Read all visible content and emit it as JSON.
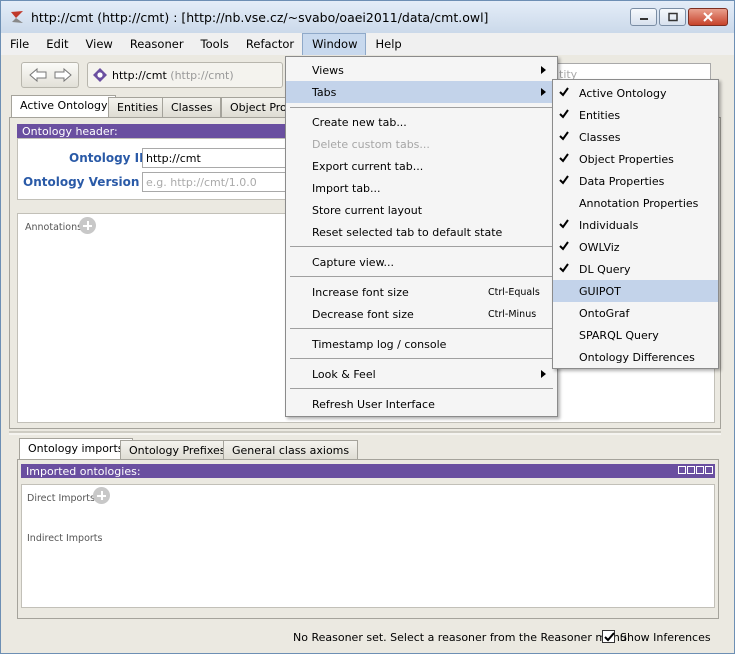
{
  "window": {
    "title": "http://cmt (http://cmt)  : [http://nb.vse.cz/~svabo/oaei2011/data/cmt.owl]"
  },
  "menubar": {
    "items": [
      "File",
      "Edit",
      "View",
      "Reasoner",
      "Tools",
      "Refactor",
      "Window",
      "Help"
    ],
    "active": "Window"
  },
  "toolbar": {
    "iri": "http://cmt",
    "iri_suffix": "(http://cmt)",
    "search_placeholder": "tity"
  },
  "tabs": [
    "Active Ontology",
    "Entities",
    "Classes",
    "Object Prop"
  ],
  "ontology_header": {
    "title": "Ontology header:",
    "iri_label": "Ontology IRI",
    "iri_value": "http://cmt",
    "version_label": "Ontology Version IRI",
    "version_placeholder": "e.g. http://cmt/1.0.0"
  },
  "annotations_label": "Annotations",
  "bottom_tabs": [
    "Ontology imports",
    "Ontology Prefixes",
    "General class axioms"
  ],
  "imports": {
    "title": "Imported ontologies:",
    "direct_label": "Direct Imports",
    "indirect_label": "Indirect Imports"
  },
  "status": {
    "text": "No Reasoner set. Select a reasoner from the Reasoner menu",
    "show_inferences_label": "Show Inferences",
    "show_inferences_checked": true
  },
  "window_menu": {
    "items": [
      {
        "label": "Views",
        "submenu": true
      },
      {
        "label": "Tabs",
        "submenu": true,
        "highlighted": true
      },
      {
        "label": "Create new tab..."
      },
      {
        "label": "Delete custom tabs...",
        "disabled": true
      },
      {
        "label": "Export current tab..."
      },
      {
        "label": "Import tab..."
      },
      {
        "label": "Store current layout"
      },
      {
        "label": "Reset selected tab to default state"
      },
      {
        "label": "Capture view..."
      },
      {
        "label": "Increase font size",
        "shortcut": "Ctrl-Equals"
      },
      {
        "label": "Decrease font size",
        "shortcut": "Ctrl-Minus"
      },
      {
        "label": "Timestamp log / console"
      },
      {
        "label": "Look & Feel",
        "submenu": true
      },
      {
        "label": "Refresh User Interface"
      }
    ]
  },
  "tabs_submenu": {
    "items": [
      {
        "label": "Active Ontology",
        "checked": true
      },
      {
        "label": "Entities",
        "checked": true
      },
      {
        "label": "Classes",
        "checked": true
      },
      {
        "label": "Object Properties",
        "checked": true
      },
      {
        "label": "Data Properties",
        "checked": true
      },
      {
        "label": "Annotation Properties",
        "checked": false
      },
      {
        "label": "Individuals",
        "checked": true
      },
      {
        "label": "OWLViz",
        "checked": true
      },
      {
        "label": "DL Query",
        "checked": true
      },
      {
        "label": "GUIPOT",
        "checked": false,
        "highlighted": true
      },
      {
        "label": "OntoGraf",
        "checked": false
      },
      {
        "label": "SPARQL Query",
        "checked": false
      },
      {
        "label": "Ontology Differences",
        "checked": false
      }
    ]
  },
  "colors": {
    "section_header": "#6a4fa0",
    "field_label": "#2a5aa7",
    "menu_highlight": "#c3d3ea"
  }
}
